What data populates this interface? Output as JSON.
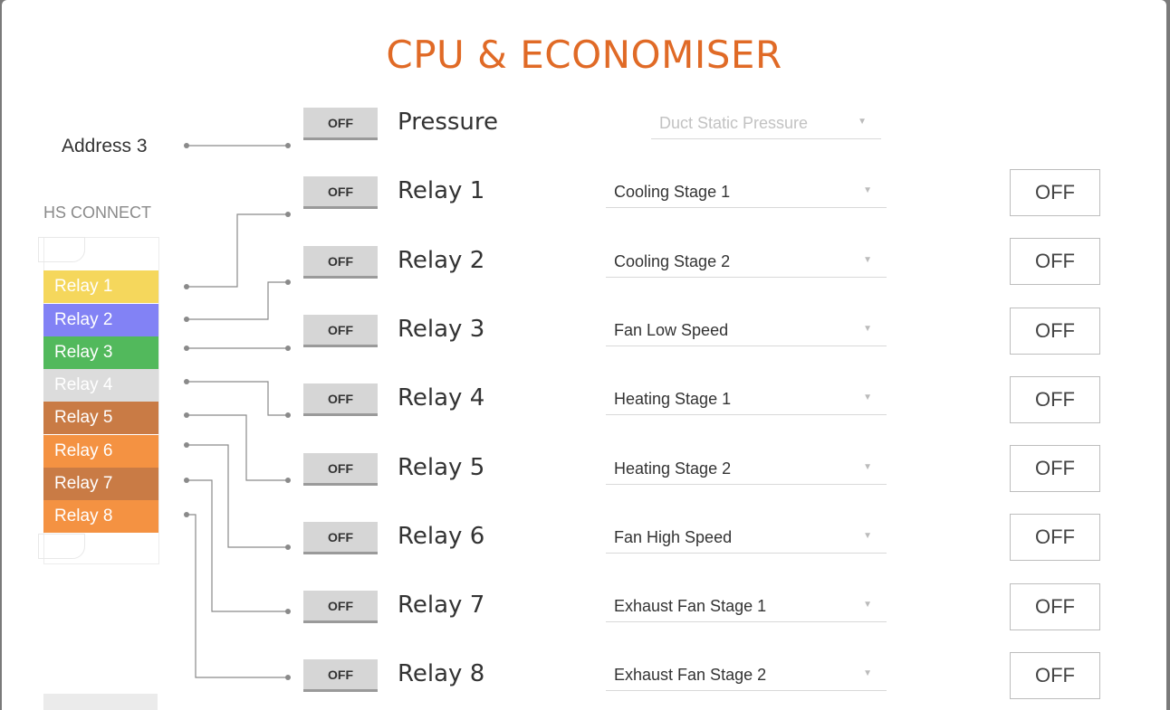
{
  "title": "CPU & ECONOMISER",
  "address_label": "Address 3",
  "hs_connect_label": "HS CONNECT",
  "pressure": {
    "button_label": "OFF",
    "label": "Pressure",
    "select_value": "Duct Static Pressure"
  },
  "relay_blocks": [
    {
      "label": "Relay 1",
      "color": "#f5d75c"
    },
    {
      "label": "Relay 2",
      "color": "#8282f5"
    },
    {
      "label": "Relay 3",
      "color": "#52b95c"
    },
    {
      "label": "Relay 4",
      "color": "#dcdcdc"
    },
    {
      "label": "Relay 5",
      "color": "#c97b45"
    },
    {
      "label": "Relay 6",
      "color": "#f49242"
    },
    {
      "label": "Relay 7",
      "color": "#c97b45"
    },
    {
      "label": "Relay 8",
      "color": "#f49242"
    }
  ],
  "relays": [
    {
      "button_label": "OFF",
      "label": "Relay 1",
      "function": "Cooling Stage 1",
      "output": "OFF"
    },
    {
      "button_label": "OFF",
      "label": "Relay 2",
      "function": "Cooling Stage 2",
      "output": "OFF"
    },
    {
      "button_label": "OFF",
      "label": "Relay 3",
      "function": "Fan Low Speed",
      "output": "OFF"
    },
    {
      "button_label": "OFF",
      "label": "Relay 4",
      "function": "Heating Stage 1",
      "output": "OFF"
    },
    {
      "button_label": "OFF",
      "label": "Relay 5",
      "function": "Heating Stage 2",
      "output": "OFF"
    },
    {
      "button_label": "OFF",
      "label": "Relay 6",
      "function": "Fan High Speed",
      "output": "OFF"
    },
    {
      "button_label": "OFF",
      "label": "Relay 7",
      "function": "Exhaust Fan Stage 1",
      "output": "OFF"
    },
    {
      "button_label": "OFF",
      "label": "Relay 8",
      "function": "Exhaust Fan Stage 2",
      "output": "OFF"
    }
  ],
  "colors": {
    "title": "#e06a26",
    "wire": "#8a8a8a"
  },
  "icons": {
    "dropdown": "caret-down-icon"
  }
}
